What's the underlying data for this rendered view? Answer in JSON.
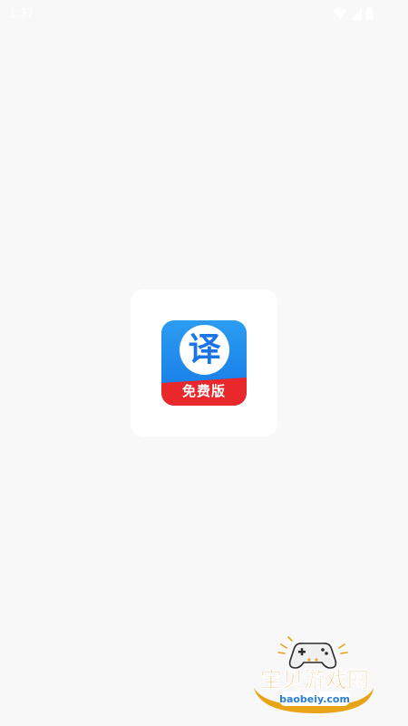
{
  "status_bar": {
    "time": "1:37",
    "icons": [
      "wifi-icon",
      "signal-icon",
      "battery-icon"
    ]
  },
  "splash": {
    "logo": {
      "glyph": "译",
      "ribbon_text": "免费版",
      "colors": {
        "blue": "#1c86ee",
        "red": "#e8282b",
        "white": "#ffffff"
      }
    }
  },
  "watermark": {
    "title": "宝贝游戏网",
    "url": "baobeiy.com"
  },
  "colors": {
    "background": "#f8f8f8",
    "card": "#ffffff"
  }
}
